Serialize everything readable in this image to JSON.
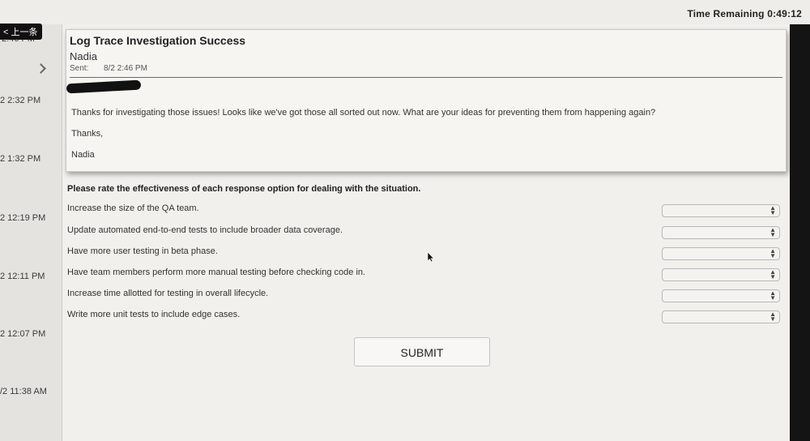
{
  "header": {
    "time_remaining": "Time Remaining 0:49:12",
    "back_label": "< 上一条"
  },
  "sidebar": {
    "items": [
      {
        "time": "2:46 PM"
      },
      {
        "time": "2 2:32 PM"
      },
      {
        "time": "2 1:32 PM"
      },
      {
        "time": "2 12:19 PM"
      },
      {
        "time": "2 12:11 PM"
      },
      {
        "time": "2 12:07 PM"
      },
      {
        "time": "/2 11:38 AM"
      }
    ]
  },
  "email": {
    "subject": "Log Trace Investigation Success",
    "sender": "Nadia",
    "sent_label": "Sent:",
    "sent_value": "8/2 2:46 PM",
    "body": [
      "Thanks for investigating those issues! Looks like we've got those all sorted out now. What are your ideas for preventing them from happening again?",
      "Thanks,",
      "Nadia"
    ]
  },
  "question": {
    "instructions": "Please rate the effectiveness of each response option for dealing with the situation.",
    "options": [
      {
        "label": "Increase the size of the QA team.",
        "selected": ""
      },
      {
        "label": "Update automated end-to-end tests to include broader data coverage.",
        "selected": ""
      },
      {
        "label": "Have more user testing in beta phase.",
        "selected": ""
      },
      {
        "label": "Have team members perform more manual testing before checking code in.",
        "selected": ""
      },
      {
        "label": "Increase time allotted for testing in overall lifecycle.",
        "selected": ""
      },
      {
        "label": "Write more unit tests to include edge cases.",
        "selected": ""
      }
    ],
    "submit_label": "SUBMIT"
  },
  "colors": {
    "background": "#f1f0ed",
    "sidebar": "#e4e3e0",
    "right_edge": "#141414"
  }
}
